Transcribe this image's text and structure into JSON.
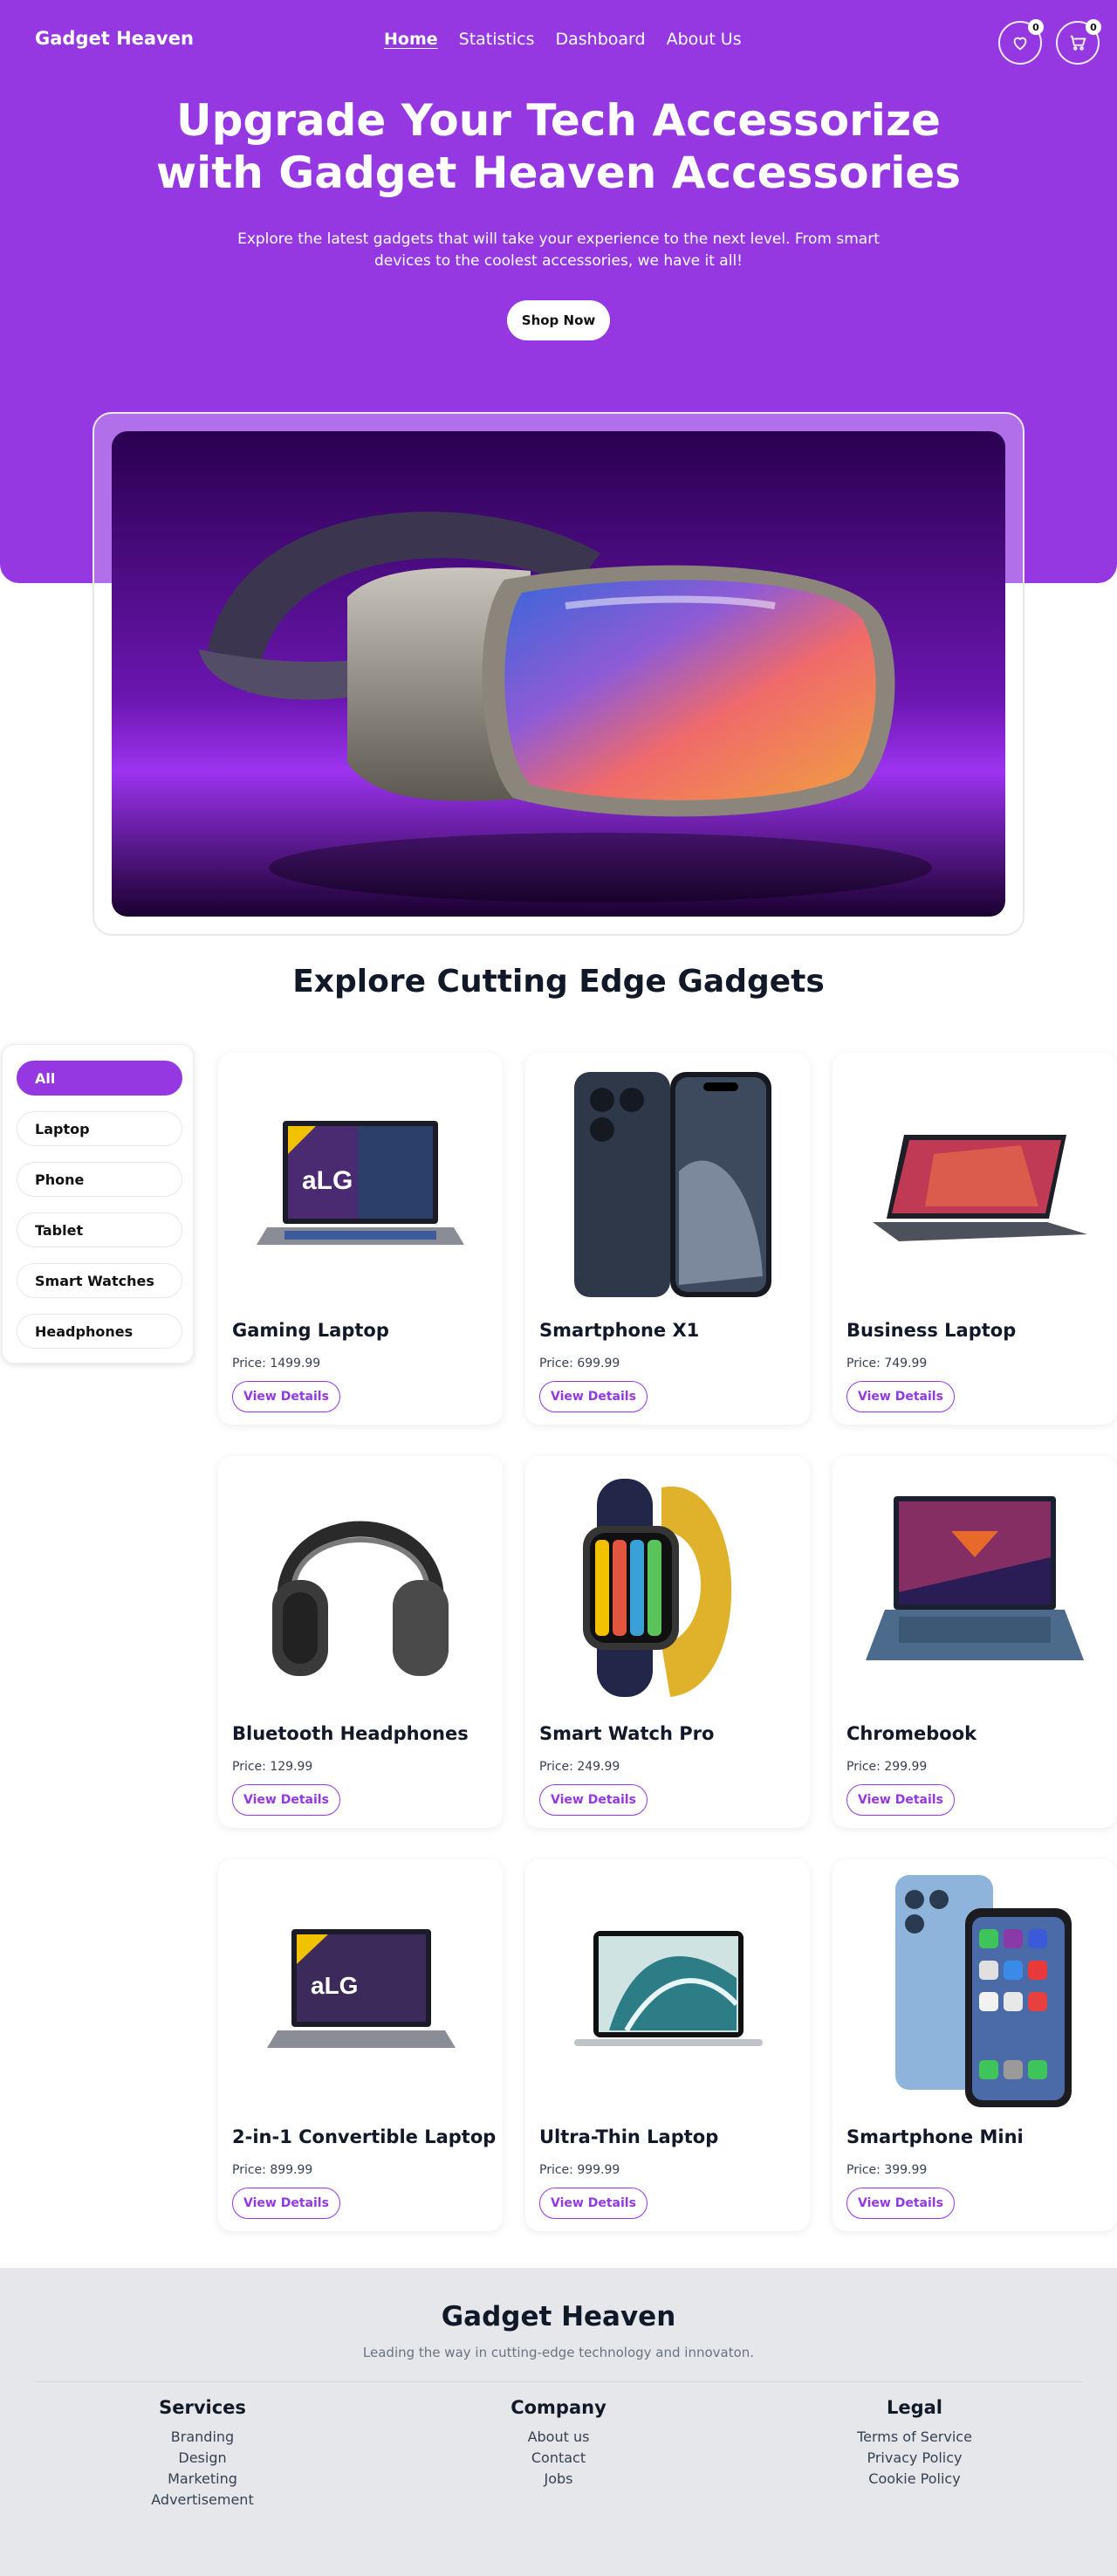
{
  "nav": {
    "brand": "Gadget Heaven",
    "links": [
      {
        "label": "Home",
        "active": true
      },
      {
        "label": "Statistics",
        "active": false
      },
      {
        "label": "Dashboard",
        "active": false
      },
      {
        "label": "About Us",
        "active": false
      }
    ],
    "wishlist_count": "0",
    "cart_count": "0"
  },
  "hero": {
    "title": "Upgrade Your Tech Accessorize with Gadget Heaven Accessories",
    "subtitle": "Explore the latest gadgets that will take your experience to the next level. From smart devices to the coolest accessories, we have it all!",
    "cta": "Shop Now"
  },
  "section": {
    "title": "Explore Cutting Edge Gadgets"
  },
  "categories": [
    "All",
    "Laptop",
    "Phone",
    "Tablet",
    "Smart Watches",
    "Headphones"
  ],
  "products": [
    {
      "name": "Gaming Laptop",
      "price": "Price: 1499.99",
      "cta": "View Details",
      "icon": "gaming-laptop"
    },
    {
      "name": "Smartphone X1",
      "price": "Price: 699.99",
      "cta": "View Details",
      "icon": "smartphone"
    },
    {
      "name": "Business Laptop",
      "price": "Price: 749.99",
      "cta": "View Details",
      "icon": "convertible-laptop"
    },
    {
      "name": "Bluetooth Headphones",
      "price": "Price: 129.99",
      "cta": "View Details",
      "icon": "headphones"
    },
    {
      "name": "Smart Watch Pro",
      "price": "Price: 249.99",
      "cta": "View Details",
      "icon": "smartwatch"
    },
    {
      "name": "Chromebook",
      "price": "Price: 299.99",
      "cta": "View Details",
      "icon": "laptop"
    },
    {
      "name": "2-in-1 Convertible Laptop",
      "price": "Price: 899.99",
      "cta": "View Details",
      "icon": "gaming-laptop"
    },
    {
      "name": "Ultra-Thin Laptop",
      "price": "Price: 999.99",
      "cta": "View Details",
      "icon": "thin-laptop"
    },
    {
      "name": "Smartphone Mini",
      "price": "Price: 399.99",
      "cta": "View Details",
      "icon": "smartphone-pair"
    }
  ],
  "footer": {
    "title": "Gadget Heaven",
    "tagline": "Leading the way in cutting-edge technology and innovaton.",
    "columns": [
      {
        "title": "Services",
        "items": [
          "Branding",
          "Design",
          "Marketing",
          "Advertisement"
        ]
      },
      {
        "title": "Company",
        "items": [
          "About us",
          "Contact",
          "Jobs"
        ]
      },
      {
        "title": "Legal",
        "items": [
          "Terms of Service",
          "Privacy Policy",
          "Cookie Policy"
        ]
      }
    ]
  },
  "colors": {
    "accent": "#9538E2",
    "footer_bg": "#e5e7eb"
  }
}
